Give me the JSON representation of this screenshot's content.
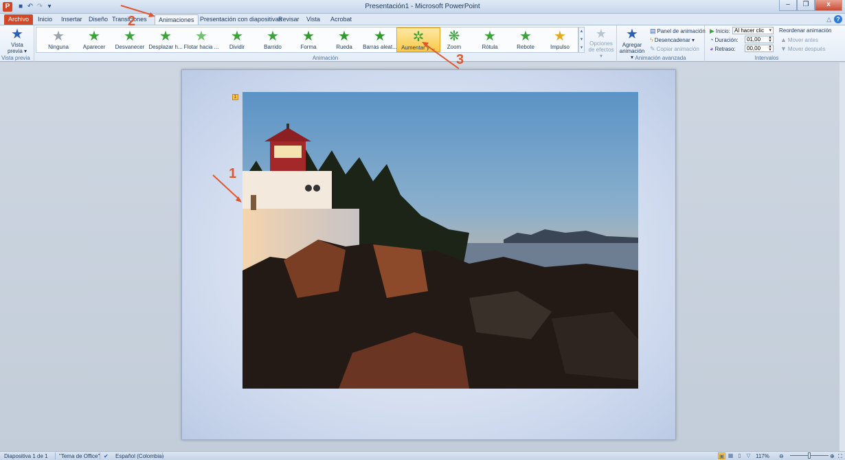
{
  "window": {
    "title": "Presentación1 - Microsoft PowerPoint",
    "app_icon_letter": "P",
    "qat": [
      "save-icon",
      "undo-icon",
      "redo-icon",
      "customize-icon"
    ]
  },
  "tabs": [
    {
      "label": "Archivo",
      "active": false
    },
    {
      "label": "Inicio",
      "active": false
    },
    {
      "label": "Insertar",
      "active": false
    },
    {
      "label": "Diseño",
      "active": false
    },
    {
      "label": "Transiciones",
      "active": false
    },
    {
      "label": "Animaciones",
      "active": true
    },
    {
      "label": "Presentación con diapositivas",
      "active": false
    },
    {
      "label": "Revisar",
      "active": false
    },
    {
      "label": "Vista",
      "active": false
    },
    {
      "label": "Acrobat",
      "active": false
    }
  ],
  "ribbon": {
    "preview": {
      "label_line1": "Vista",
      "label_line2": "previa ▾",
      "group_label": "Vista previa"
    },
    "animation_group_label": "Animación",
    "gallery": [
      {
        "label": "Ninguna",
        "color": "#9aa3ad",
        "selected": false
      },
      {
        "label": "Aparecer",
        "color": "#3aa33a",
        "selected": false
      },
      {
        "label": "Desvanecer",
        "color": "#3aa33a",
        "selected": false
      },
      {
        "label": "Desplazar h...",
        "color": "#3aa33a",
        "selected": false
      },
      {
        "label": "Flotar hacia ...",
        "color": "#6fc06f",
        "selected": false
      },
      {
        "label": "Dividir",
        "color": "#3aa33a",
        "selected": false
      },
      {
        "label": "Barrido",
        "color": "#3aa33a",
        "selected": false
      },
      {
        "label": "Forma",
        "color": "#2e9a2e",
        "selected": false
      },
      {
        "label": "Rueda",
        "color": "#2e9a2e",
        "selected": false
      },
      {
        "label": "Barras aleat...",
        "color": "#2e9a2e",
        "selected": false
      },
      {
        "label": "Aumentar y ...",
        "color": "#3aa33a",
        "selected": true
      },
      {
        "label": "Zoom",
        "color": "#3aa33a",
        "selected": false
      },
      {
        "label": "Rótula",
        "color": "#3aa33a",
        "selected": false
      },
      {
        "label": "Rebote",
        "color": "#3aa33a",
        "selected": false
      },
      {
        "label": "Impulso",
        "color": "#e8a81c",
        "selected": false
      }
    ],
    "effect_options": {
      "line1": "Opciones",
      "line2": "de efectos ▾"
    },
    "advanced": {
      "add_line1": "Agregar",
      "add_line2": "animación ▾",
      "panel": "Panel de animación",
      "trigger": "Desencadenar ▾",
      "copy": "Copiar animación",
      "group_label": "Animación avanzada"
    },
    "timing": {
      "start_label": "Inicio:",
      "start_value": "Al hacer clic",
      "duration_label": "Duración:",
      "duration_value": "01,00",
      "delay_label": "Retraso:",
      "delay_value": "00,00",
      "reorder": "Reordenar animación",
      "move_earlier": "Mover antes",
      "move_later": "Mover después",
      "group_label": "Intervalos"
    }
  },
  "slide": {
    "anim_tag": "1"
  },
  "annotations": [
    "1",
    "2",
    "3"
  ],
  "status": {
    "slide": "Diapositiva 1 de 1",
    "theme": "\"Tema de Office\"",
    "language": "Español (Colombia)",
    "zoom": "117%"
  }
}
